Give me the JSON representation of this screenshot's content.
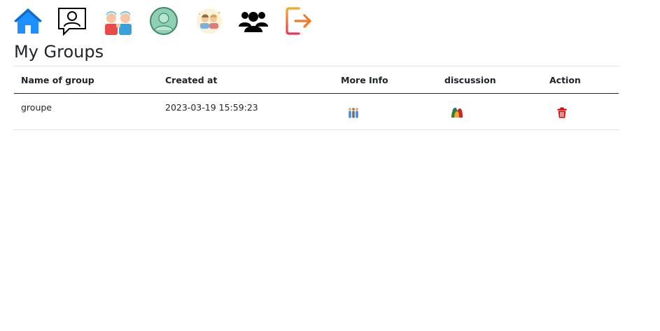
{
  "nav": {
    "items": [
      {
        "icon": "home-icon"
      },
      {
        "icon": "profile-chat-icon"
      },
      {
        "icon": "friends-icon"
      },
      {
        "icon": "avatar-icon"
      },
      {
        "icon": "couple-icon"
      },
      {
        "icon": "groups-icon"
      },
      {
        "icon": "logout-icon"
      }
    ]
  },
  "page": {
    "title": "My Groups"
  },
  "table": {
    "columns": [
      "Name of group",
      "Created at",
      "More Info",
      "discussion",
      "Action"
    ],
    "rows": [
      {
        "name": "groupe",
        "created_at": "2023-03-19 15:59:23",
        "more_info_icon": "group-info-icon",
        "discussion_icon": "discussion-icon",
        "action_icon": "trash-icon"
      }
    ]
  },
  "colors": {
    "home": "#1e90ff",
    "logout_gradient_start": "#f7a823",
    "logout_gradient_end": "#e8375a",
    "delete": "#e00000",
    "header_rule": "#212529",
    "row_rule": "#dee2e6"
  }
}
